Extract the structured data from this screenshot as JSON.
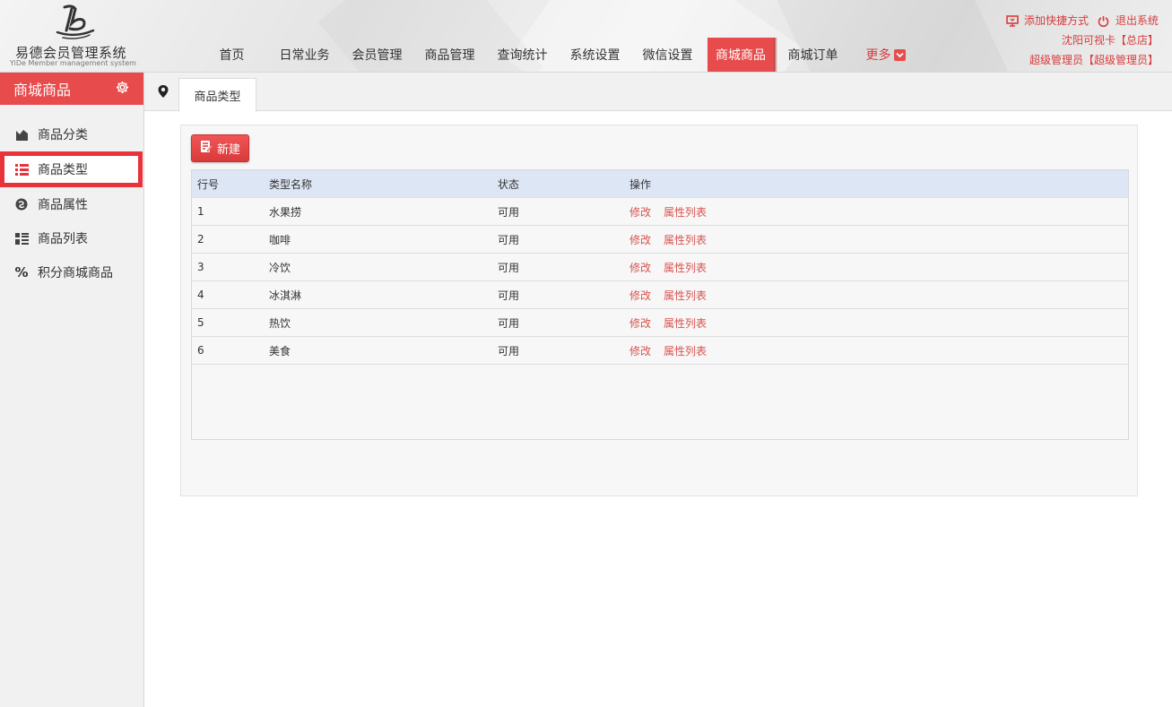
{
  "header": {
    "logo_title": "易德会员管理系统",
    "logo_subtitle": "YiDe Member management system",
    "nav": [
      {
        "label": "首页",
        "active": false
      },
      {
        "label": "日常业务",
        "active": false
      },
      {
        "label": "会员管理",
        "active": false
      },
      {
        "label": "商品管理",
        "active": false
      },
      {
        "label": "查询统计",
        "active": false
      },
      {
        "label": "系统设置",
        "active": false
      },
      {
        "label": "微信设置",
        "active": false
      },
      {
        "label": "商城商品",
        "active": true
      },
      {
        "label": "商城订单",
        "active": false
      }
    ],
    "more_label": "更多",
    "add_shortcut": "添加快捷方式",
    "logout": "退出系统",
    "store": "沈阳可视卡【总店】",
    "user": "超级管理员【超级管理员】"
  },
  "sidebar": {
    "title": "商城商品",
    "items": [
      {
        "label": "商品分类",
        "icon": "category-icon",
        "active": false
      },
      {
        "label": "商品类型",
        "icon": "list-icon",
        "active": true
      },
      {
        "label": "商品属性",
        "icon": "attribute-icon",
        "active": false
      },
      {
        "label": "商品列表",
        "icon": "grid-icon",
        "active": false
      },
      {
        "label": "积分商城商品",
        "icon": "percent-icon",
        "active": false
      }
    ]
  },
  "tabs": {
    "current": "商品类型"
  },
  "toolbar": {
    "new_label": "新建"
  },
  "table": {
    "headers": [
      "行号",
      "类型名称",
      "状态",
      "操作"
    ],
    "rows": [
      {
        "no": "1",
        "name": "水果捞",
        "status": "可用",
        "edit": "修改",
        "attrs": "属性列表"
      },
      {
        "no": "2",
        "name": "咖啡",
        "status": "可用",
        "edit": "修改",
        "attrs": "属性列表"
      },
      {
        "no": "3",
        "name": "冷饮",
        "status": "可用",
        "edit": "修改",
        "attrs": "属性列表"
      },
      {
        "no": "4",
        "name": "冰淇淋",
        "status": "可用",
        "edit": "修改",
        "attrs": "属性列表"
      },
      {
        "no": "5",
        "name": "热饮",
        "status": "可用",
        "edit": "修改",
        "attrs": "属性列表"
      },
      {
        "no": "6",
        "name": "美食",
        "status": "可用",
        "edit": "修改",
        "attrs": "属性列表"
      }
    ]
  },
  "colors": {
    "accent": "#e84b4b",
    "highlight_border": "#e8333a",
    "link": "#d9534f",
    "table_header_bg": "#dde6f5"
  }
}
